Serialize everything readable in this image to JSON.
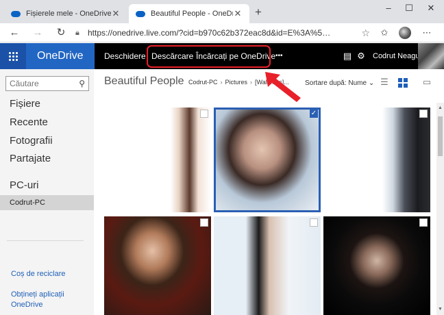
{
  "browser": {
    "tabs": [
      {
        "title": "Fișierele mele - OneDrive",
        "active": false
      },
      {
        "title": "Beautiful People - OneDrive",
        "active": true
      }
    ],
    "new_tab_glyph": "+",
    "url": "https://onedrive.live.com/?cid=b970c62b372eac8d&id=E%3A%5…",
    "window_controls": [
      "–",
      "☐",
      "✕"
    ]
  },
  "onedrive": {
    "brand": "OneDrive",
    "commands": {
      "open": "Deschidere",
      "download": "Descărcare",
      "upload": "Încărcați pe OneDrive",
      "more": "•••"
    },
    "user_name": "Codrut Neagu"
  },
  "sidebar": {
    "search_placeholder": "Căutare",
    "nav": [
      "Fișiere",
      "Recente",
      "Fotografii",
      "Partajate"
    ],
    "pcs_heading": "PC-uri",
    "pc_item": "Codrut-PC",
    "recycle": "Coș de reciclare",
    "get_apps_line1": "Obțineți aplicații",
    "get_apps_line2": "OneDrive"
  },
  "content": {
    "folder_title": "Beautiful People",
    "breadcrumb": [
      "Codrut-PC",
      "Pictures",
      "[Wall...ers]..."
    ],
    "sort_label": "Sortare după: Nume",
    "photos_selected": [
      false,
      true,
      false,
      false,
      false,
      false
    ]
  },
  "colors": {
    "accent": "#2266c3",
    "annotation": "#e8202a",
    "selection": "#2a5fb3"
  }
}
